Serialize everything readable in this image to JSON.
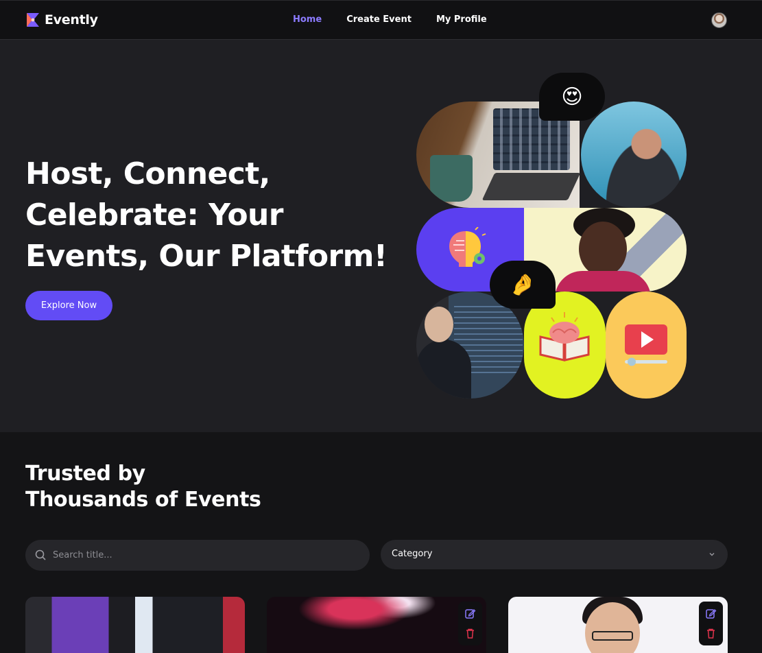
{
  "nav": {
    "logo_text": "Evently",
    "links": [
      "Home",
      "Create Event",
      "My Profile"
    ],
    "active": "Home"
  },
  "hero": {
    "title": "Host, Connect, Celebrate: Your Events, Our Platform!",
    "cta_label": "Explore Now",
    "bubble_1_emoji": "😍",
    "bubble_2_emoji": "🤌"
  },
  "trusted": {
    "title_line_1": "Trusted by",
    "title_line_2": "Thousands of Events"
  },
  "search": {
    "placeholder": "Search title...",
    "value": ""
  },
  "category": {
    "label": "Category"
  },
  "colors": {
    "accent": "#624cf5",
    "nav_active": "#8c7bff",
    "hero_bg": "#1f1f23",
    "page_bg": "#141416",
    "delete_icon": "#e0334c"
  },
  "cards": [
    {
      "image": "graduation-photo",
      "has_actions": false
    },
    {
      "image": "fireworks-photo",
      "has_actions": true
    },
    {
      "image": "portrait-photo",
      "has_actions": true
    }
  ]
}
